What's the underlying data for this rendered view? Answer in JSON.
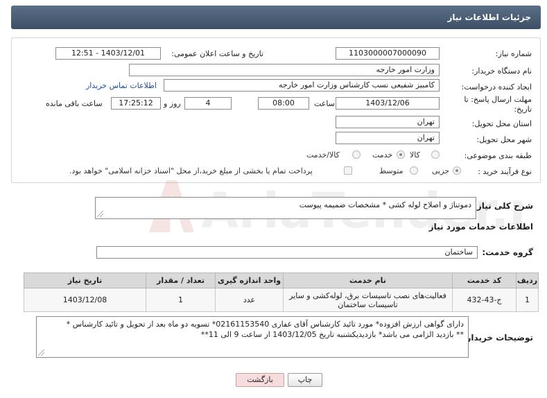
{
  "header": {
    "title": "جزئیات اطلاعات نیاز"
  },
  "form": {
    "need_number_label": "شماره نیاز:",
    "need_number": "1103000007000090",
    "announce_label": "تاریخ و ساعت اعلان عمومی:",
    "announce_value": "1403/12/01 - 12:51",
    "buyer_org_label": "نام دستگاه خریدار:",
    "buyer_org": "وزارت امور خارجه",
    "requester_label": "ایجاد کننده درخواست:",
    "requester": "کامبیز شفیعی نسب کارشناس وزارت امور خارجه",
    "contact_link": "اطلاعات تماس خریدار",
    "deadline_label_1": "مهلت ارسال پاسخ: تا",
    "deadline_label_2": "تاریخ:",
    "deadline_date": "1403/12/06",
    "time_label": "ساعت",
    "deadline_time": "08:00",
    "days_value": "4",
    "days_label": "روز و",
    "remaining_time": "17:25:12",
    "remaining_label": "ساعت باقی مانده",
    "province_label": "استان محل تحویل:",
    "province": "تهران",
    "city_label": "شهر محل تحویل:",
    "city": "تهران",
    "category_label": "طبقه بندی موضوعی:",
    "category_options": [
      "کالا",
      "خدمت",
      "کالا/خدمت"
    ],
    "process_label": "نوع فرآیند خرید :",
    "process_options": [
      "جزیی",
      "متوسط"
    ],
    "treasury_note": "پرداخت تمام یا بخشی از مبلغ خرید،از محل \"اسناد خزانه اسلامی\" خواهد بود."
  },
  "summary": {
    "label": "شرح کلی نیاز:",
    "text": "دموتناژ و اصلاح لوله کشی * مشخصات ضمیمه پیوست"
  },
  "services": {
    "section_label": "اطلاعات خدمات مورد نیاز",
    "group_label": "گروه خدمت:",
    "group_value": "ساختمان",
    "columns": [
      "ردیف",
      "کد خدمت",
      "نام خدمت",
      "واحد اندازه گیری",
      "تعداد / مقدار",
      "تاریخ نیاز"
    ],
    "rows": [
      {
        "row": "1",
        "code": "ج-43-432",
        "name": "فعالیت‌های نصب تاسیسات برق، لوله‌کشی و سایر تاسیسات ساختمان",
        "unit": "عدد",
        "qty": "1",
        "date": "1403/12/08"
      }
    ]
  },
  "buyer_notes": {
    "label": "توضیحات خریدار:",
    "line1": "دارای گواهی ارزش افزوده* مورد تائید کارشناس آقای غفاری 02161153540* تسویه دو ماه بعد از تحویل و تائید کارشناس *",
    "line2": "** بازدید الزامی می باشد* بازدیدیکشنبه   تاریخ 1403/12/05 از ساعت 9 الی 11**"
  },
  "buttons": {
    "print": "چاپ",
    "back": "بازگشت"
  },
  "watermark": {
    "text": "AriaTender.neT"
  },
  "colors": {
    "header_bg": "#4a5d75",
    "link": "#1a4fa0",
    "back_button": "#f6dcdc"
  }
}
